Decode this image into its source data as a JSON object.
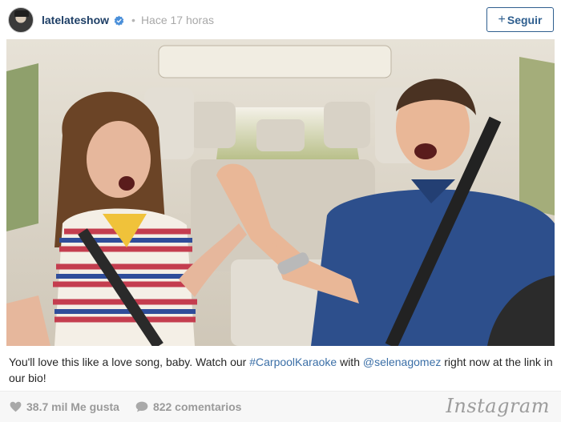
{
  "header": {
    "username": "latelateshow",
    "separator": "•",
    "timestamp": "Hace 17 horas",
    "follow_label": "Seguir",
    "follow_icon": "plus-icon",
    "verified_icon": "verified-badge-icon"
  },
  "post": {
    "photo_description_icon": "carpool-karaoke-photo",
    "caption": {
      "text_1": "You'll love this like a love song, baby. Watch our ",
      "hashtag": "#CarpoolKaraoke",
      "text_2": " with ",
      "mention": "@selenagomez",
      "text_3": " right now at the link in our bio!"
    }
  },
  "footer": {
    "likes": "38.7 mil Me gusta",
    "comments": "822 comentarios",
    "brand": "Instagram",
    "like_icon": "heart-icon",
    "comment_icon": "comment-bubble-icon"
  },
  "colors": {
    "username": "#1e3f66",
    "link": "#3b6fa7",
    "follow": "#2f5f8f",
    "muted": "#9a9a9a"
  }
}
